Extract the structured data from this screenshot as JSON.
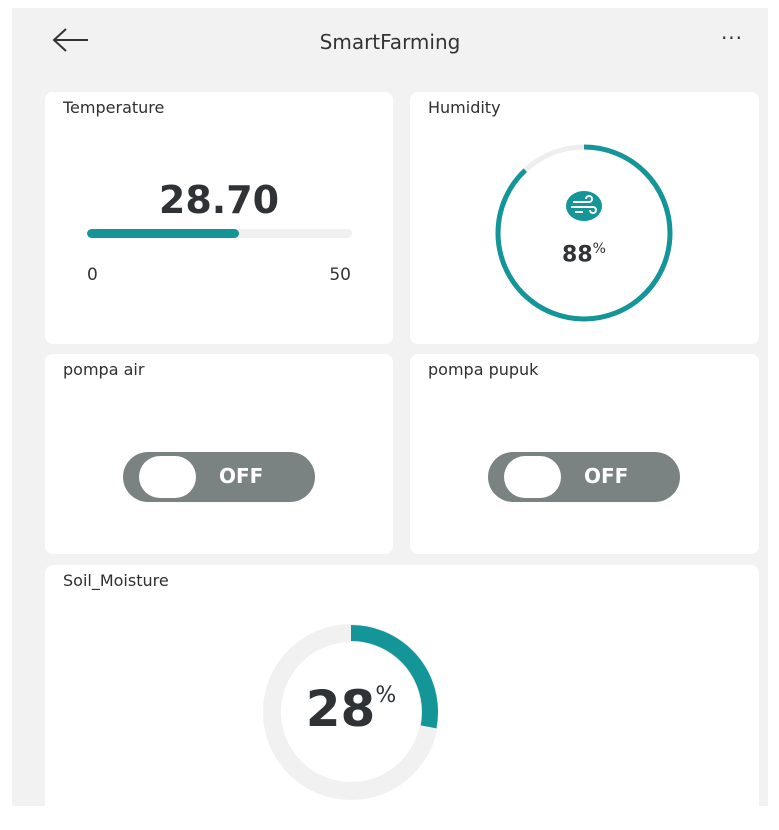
{
  "header": {
    "title": "SmartFarming",
    "back_icon": "arrow-left-icon",
    "more_label": "···",
    "more_icon": "more-horizontal-icon"
  },
  "temperature": {
    "label": "Temperature",
    "value": "28.70",
    "min": "0",
    "max": "50",
    "fraction": 0.574,
    "accent": "#149597"
  },
  "humidity": {
    "label": "Humidity",
    "value": "88",
    "unit": "%",
    "fraction": 0.88,
    "icon": "wind-icon",
    "accent": "#149597"
  },
  "pompa_air": {
    "label": "pompa air",
    "state": "OFF",
    "toggle_color": "#7b8382"
  },
  "pompa_pupuk": {
    "label": "pompa pupuk",
    "state": "OFF",
    "toggle_color": "#7b8382"
  },
  "soil": {
    "label": "Soil_Moisture",
    "value": "28",
    "unit": "%",
    "fraction": 0.28,
    "accent": "#149597"
  }
}
